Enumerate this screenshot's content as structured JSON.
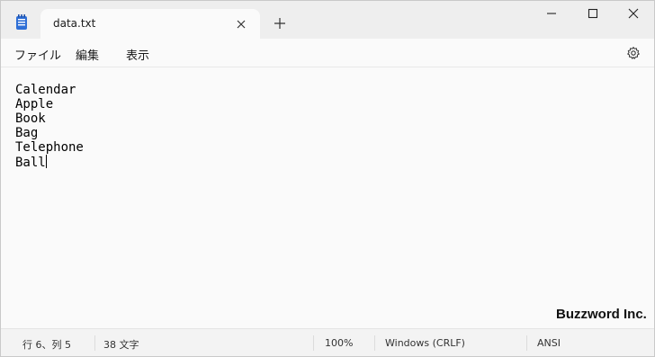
{
  "tab": {
    "title": "data.txt"
  },
  "menu": {
    "file": "ファイル",
    "edit": "編集",
    "view": "表示"
  },
  "editor": {
    "lines": [
      "Calendar",
      "Apple",
      "Book",
      "Bag",
      "Telephone",
      "Ball"
    ]
  },
  "watermark": "Buzzword Inc.",
  "status": {
    "position": "行 6、列 5",
    "chars": "38 文字",
    "zoom": "100%",
    "line_ending": "Windows (CRLF)",
    "encoding": "ANSI"
  },
  "colors": {
    "icon_accent": "#2f6fd6",
    "background": "#fafafa",
    "titlebar": "#eeeeee"
  }
}
